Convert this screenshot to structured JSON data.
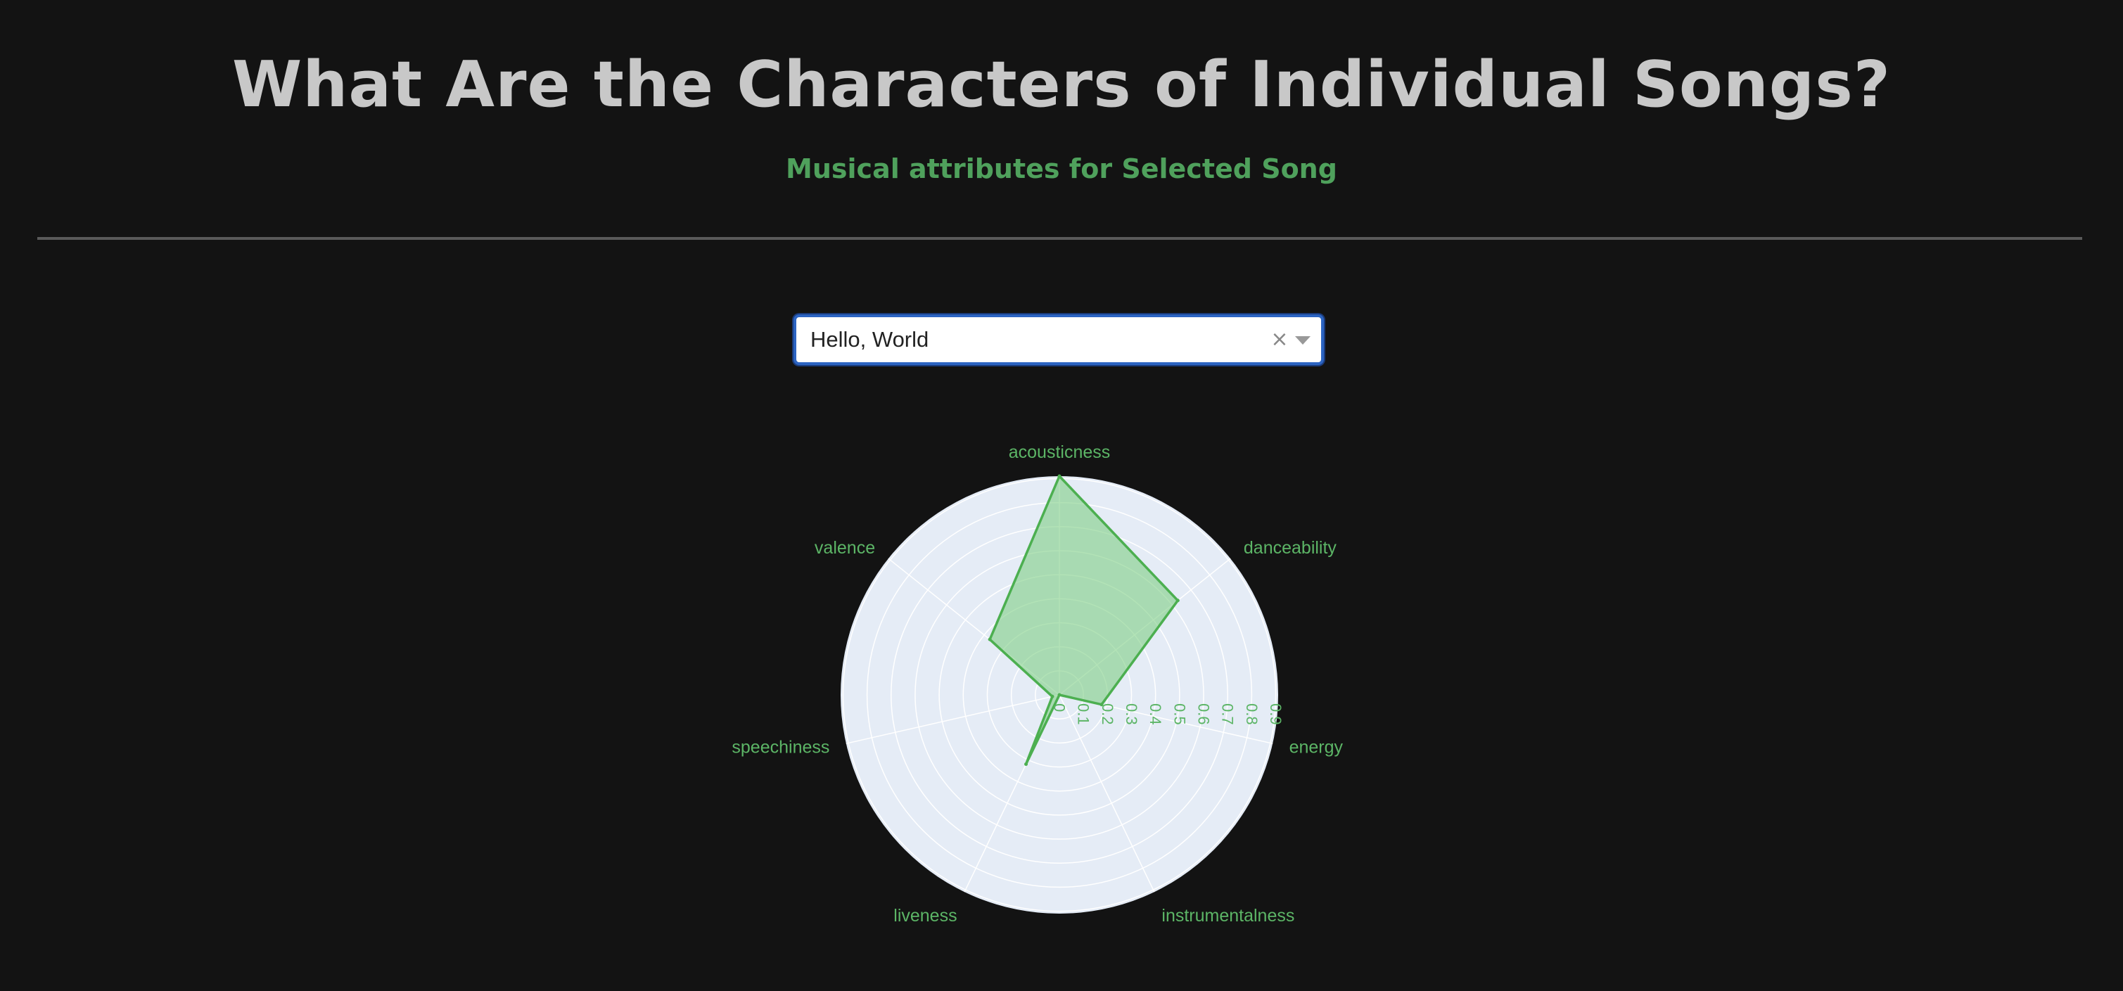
{
  "header": {
    "title": "What Are the Characters of Individual Songs?",
    "subtitle": "Musical attributes for Selected Song"
  },
  "song_selector": {
    "value": "Hello, World",
    "clear_symbol": "×",
    "icons": [
      "close-icon",
      "caret-down-icon"
    ]
  },
  "chart_data": {
    "type": "radar",
    "categories": [
      "acousticness",
      "danceability",
      "energy",
      "instrumentalness",
      "liveness",
      "speechiness",
      "valence"
    ],
    "values": [
      0.91,
      0.63,
      0.18,
      0.0,
      0.32,
      0.03,
      0.37
    ],
    "radial_tick_labels": [
      "0",
      "0.1",
      "0.2",
      "0.3",
      "0.4",
      "0.5",
      "0.6",
      "0.7",
      "0.8",
      "0.9"
    ],
    "radial_range": [
      0,
      0.91
    ],
    "grid": true,
    "colors": {
      "fill": "#7fcf86",
      "line": "#4caf50",
      "background": "#e5ecf6",
      "labels": "#5cb566"
    }
  },
  "colors": {
    "page_background": "#131313",
    "title": "#c8c8c8",
    "accent": "#4fa15c"
  }
}
